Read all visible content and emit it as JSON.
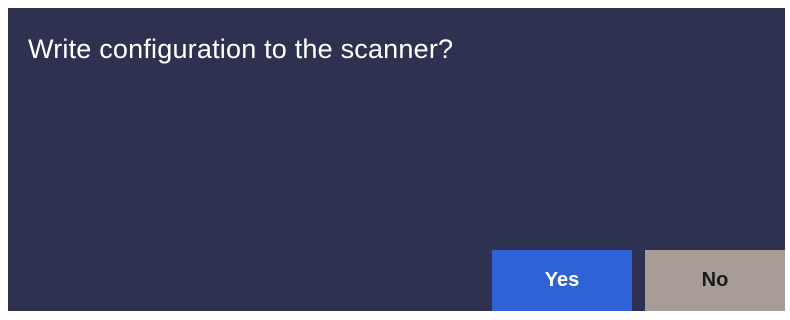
{
  "dialog": {
    "message": "Write configuration to the scanner?",
    "yes_label": "Yes",
    "no_label": "No"
  },
  "colors": {
    "dialog_background": "#2e3150",
    "message_text": "#ffffff",
    "yes_button": "#2f62d6",
    "yes_text": "#ffffff",
    "no_button": "#a79c96",
    "no_text": "#1a1a1a"
  }
}
